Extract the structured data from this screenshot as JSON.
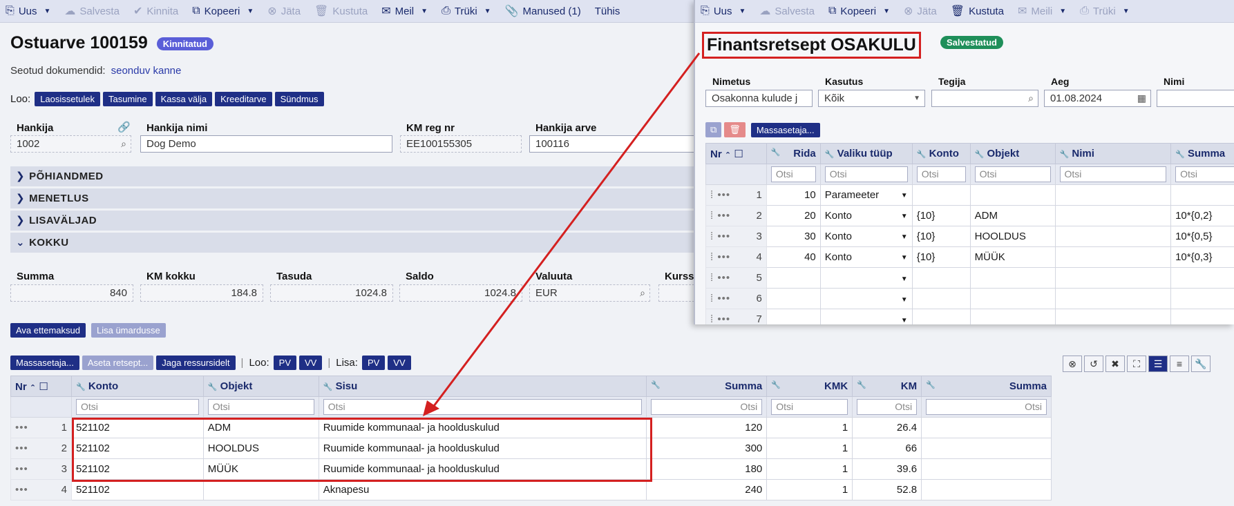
{
  "toolbar": {
    "items": [
      {
        "label": "Uus",
        "icon": "new-document-icon",
        "caret": true,
        "disabled": false
      },
      {
        "label": "Salvesta",
        "icon": "cloud-upload-icon",
        "caret": false,
        "disabled": true
      },
      {
        "label": "Kinnita",
        "icon": "checkmark-icon",
        "caret": false,
        "disabled": true
      },
      {
        "label": "Kopeeri",
        "icon": "copy-icon",
        "caret": true,
        "disabled": false
      },
      {
        "label": "Jäta",
        "icon": "cancel-circle-icon",
        "caret": false,
        "disabled": true
      },
      {
        "label": "Kustuta",
        "icon": "trash-icon",
        "caret": false,
        "disabled": true
      },
      {
        "label": "Meil",
        "icon": "mail-icon",
        "caret": true,
        "disabled": false
      },
      {
        "label": "Trüki",
        "icon": "printer-icon",
        "caret": true,
        "disabled": false
      },
      {
        "label": "Manused (1)",
        "icon": "paperclip-icon",
        "caret": false,
        "disabled": false
      },
      {
        "label": "Tühis",
        "icon": "",
        "caret": false,
        "disabled": false
      }
    ]
  },
  "document": {
    "title": "Ostuarve 100159",
    "status": "Kinnitatud",
    "linked_label": "Seotud dokumendid:",
    "linked_link": "seonduv kanne",
    "loo_label": "Loo:",
    "loo_buttons": [
      "Laosissetulek",
      "Tasumine",
      "Kassa välja",
      "Kreeditarve",
      "Sündmus"
    ]
  },
  "header_fields": {
    "hankija_label": "Hankija",
    "hankija": "1002",
    "hankija_nimi_label": "Hankija nimi",
    "hankija_nimi": "Dog Demo",
    "km_reg_label": "KM reg nr",
    "km_reg": "EE100155305",
    "hankija_arve_label": "Hankija arve",
    "hankija_arve": "100116"
  },
  "sections": [
    "PÕHIANDMED",
    "MENETLUS",
    "LISAVÄLJAD",
    "KOKKU"
  ],
  "totals": {
    "summa_label": "Summa",
    "summa": "840",
    "km_label": "KM kokku",
    "km": "184.8",
    "tasuda_label": "Tasuda",
    "tasuda": "1024.8",
    "saldo_label": "Saldo",
    "saldo": "1024.8",
    "valuuta_label": "Valuuta",
    "valuuta": "EUR",
    "kurss_label": "Kurss"
  },
  "prepay": {
    "ava": "Ava ettemaksud",
    "lisa": "Lisa ümardusse"
  },
  "rows_toolbar": {
    "mass": "Massasetaja...",
    "aseta": "Aseta retsept...",
    "jaga": "Jaga ressursidelt",
    "loo_label": "Loo:",
    "lisa_label": "Lisa:",
    "pv": "PV",
    "vv": "VV"
  },
  "rows_grid": {
    "headers": {
      "nr": "Nr",
      "konto": "Konto",
      "objekt": "Objekt",
      "sisu": "Sisu",
      "summa": "Summa",
      "kmk": "KMK",
      "km": "KM",
      "summa2": "Summa"
    },
    "search": "Otsi",
    "rows": [
      {
        "nr": "1",
        "konto": "521102",
        "objekt": "ADM",
        "sisu": "Ruumide kommunaal- ja hoolduskulud",
        "summa": "120",
        "kmk": "1",
        "km": "26.4"
      },
      {
        "nr": "2",
        "konto": "521102",
        "objekt": "HOOLDUS",
        "sisu": "Ruumide kommunaal- ja hoolduskulud",
        "summa": "300",
        "kmk": "1",
        "km": "66"
      },
      {
        "nr": "3",
        "konto": "521102",
        "objekt": "MÜÜK",
        "sisu": "Ruumide kommunaal- ja hoolduskulud",
        "summa": "180",
        "kmk": "1",
        "km": "39.6"
      },
      {
        "nr": "4",
        "konto": "521102",
        "objekt": "",
        "sisu": "Aknapesu",
        "summa": "240",
        "kmk": "1",
        "km": "52.8"
      }
    ]
  },
  "popup": {
    "toolbar": [
      {
        "label": "Uus",
        "icon": "new-document-icon",
        "caret": true,
        "disabled": false
      },
      {
        "label": "Salvesta",
        "icon": "cloud-upload-icon",
        "caret": false,
        "disabled": true
      },
      {
        "label": "Kopeeri",
        "icon": "copy-icon",
        "caret": true,
        "disabled": false
      },
      {
        "label": "Jäta",
        "icon": "cancel-circle-icon",
        "caret": false,
        "disabled": true
      },
      {
        "label": "Kustuta",
        "icon": "trash-icon",
        "caret": false,
        "disabled": false
      },
      {
        "label": "Meili",
        "icon": "mail-icon",
        "caret": true,
        "disabled": true
      },
      {
        "label": "Trüki",
        "icon": "printer-icon",
        "caret": true,
        "disabled": true
      }
    ],
    "title": "Finantsretsept OSAKULU",
    "status": "Salvestatud",
    "fields": {
      "nimetus_label": "Nimetus",
      "nimetus": "Osakonna kulude j",
      "kasutus_label": "Kasutus",
      "kasutus": "Kõik",
      "tegija_label": "Tegija",
      "tegija": "",
      "aeg_label": "Aeg",
      "aeg": "01.08.2024",
      "nimi_label": "Nimi"
    },
    "mass": "Massasetaja...",
    "grid": {
      "headers": {
        "nr": "Nr",
        "rida": "Rida",
        "tyyp": "Valiku tüüp",
        "konto": "Konto",
        "objekt": "Objekt",
        "nimi": "Nimi",
        "summa": "Summa"
      },
      "search": "Otsi",
      "rows": [
        {
          "nr": "1",
          "rida": "10",
          "tyyp": "Parameeter",
          "konto": "",
          "objekt": "",
          "summa": ""
        },
        {
          "nr": "2",
          "rida": "20",
          "tyyp": "Konto",
          "konto": "{10}",
          "objekt": "ADM",
          "summa": "10*{0,2}"
        },
        {
          "nr": "3",
          "rida": "30",
          "tyyp": "Konto",
          "konto": "{10}",
          "objekt": "HOOLDUS",
          "summa": "10*{0,5}"
        },
        {
          "nr": "4",
          "rida": "40",
          "tyyp": "Konto",
          "konto": "{10}",
          "objekt": "MÜÜK",
          "summa": "10*{0,3}"
        },
        {
          "nr": "5",
          "rida": "",
          "tyyp": "",
          "konto": "",
          "objekt": "",
          "summa": ""
        },
        {
          "nr": "6",
          "rida": "",
          "tyyp": "",
          "konto": "",
          "objekt": "",
          "summa": ""
        },
        {
          "nr": "7",
          "rida": "",
          "tyyp": "",
          "konto": "",
          "objekt": "",
          "summa": ""
        }
      ]
    }
  },
  "colors": {
    "accent": "#1f2f86",
    "highlight": "#d42020",
    "status_blue": "#5a5ed8",
    "status_green": "#1f8f5a"
  }
}
